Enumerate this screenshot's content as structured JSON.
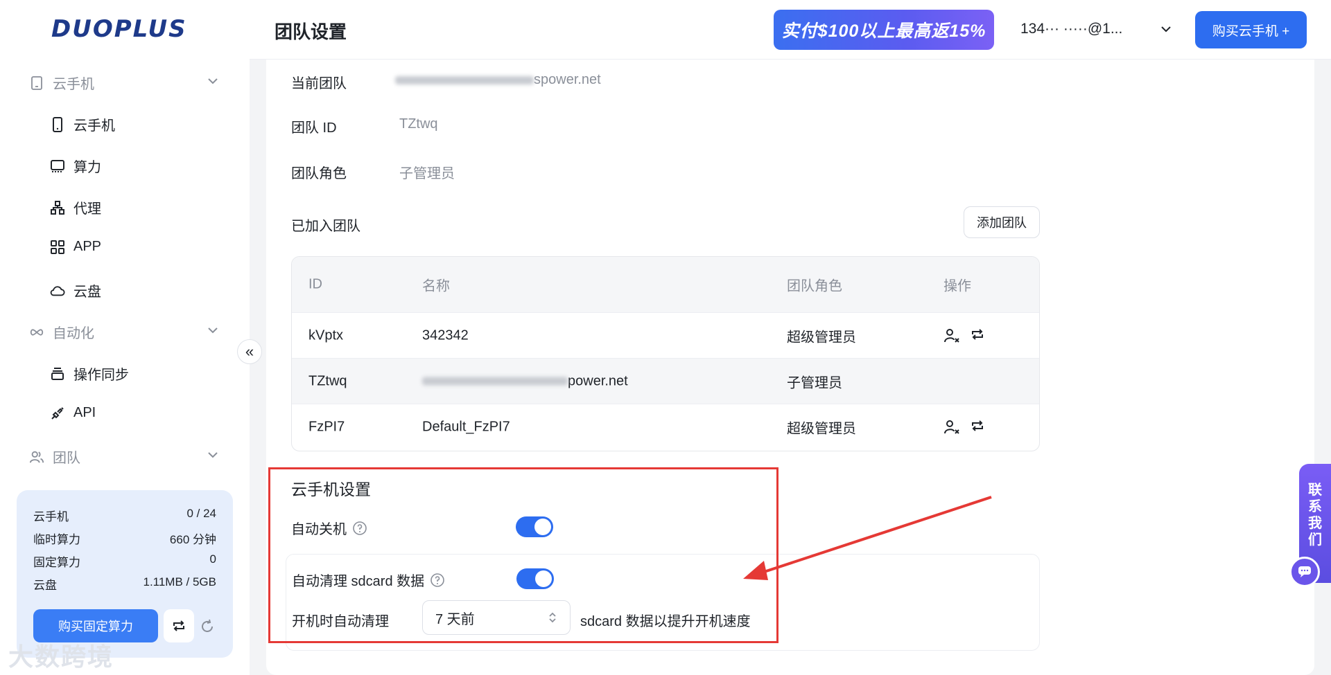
{
  "app": {
    "logo": "DUOPLUS",
    "watermark": "大数跨境"
  },
  "sidebar": {
    "groups": [
      {
        "label": "云手机",
        "icon": "phone-frame-icon"
      },
      {
        "label": "自动化",
        "icon": "infinity-icon"
      },
      {
        "label": "团队",
        "icon": "team-icon"
      }
    ],
    "items": [
      {
        "label": "云手机",
        "icon": "phone-icon"
      },
      {
        "label": "算力",
        "icon": "monitor-icon"
      },
      {
        "label": "代理",
        "icon": "network-icon"
      },
      {
        "label": "APP",
        "icon": "grid-icon"
      },
      {
        "label": "云盘",
        "icon": "cloud-icon"
      },
      {
        "label": "操作同步",
        "icon": "stack-icon"
      },
      {
        "label": "API",
        "icon": "plug-icon"
      }
    ],
    "usage": {
      "rows": [
        {
          "label": "云手机",
          "value": "0 / 24"
        },
        {
          "label": "临时算力",
          "value": "660 分钟"
        },
        {
          "label": "固定算力",
          "value": "0"
        },
        {
          "label": "云盘",
          "value": "1.11MB / 5GB"
        }
      ],
      "buy_fixed_label": "购买固定算力"
    }
  },
  "header": {
    "title": "团队设置",
    "promo": "实付$100以上最高返15%",
    "user_email": "134··· ·····@1...",
    "buy_button": "购买云手机 +"
  },
  "team_info": {
    "current_team_label": "当前团队",
    "current_team_value": "spower.net",
    "team_id_label": "团队 ID",
    "team_id_value": "TZtwq",
    "team_role_label": "团队角色",
    "team_role_value": "子管理员",
    "joined_label": "已加入团队",
    "add_team_label": "添加团队"
  },
  "table": {
    "headers": [
      "ID",
      "名称",
      "团队角色",
      "操作"
    ],
    "rows": [
      {
        "id": "kVptx",
        "name": "342342",
        "role": "超级管理员",
        "ops": true
      },
      {
        "id": "TZtwq",
        "name": "power.net",
        "role": "子管理员",
        "ops": false
      },
      {
        "id": "FzPI7",
        "name": "Default_FzPI7",
        "role": "超级管理员",
        "ops": true
      }
    ]
  },
  "phone_settings": {
    "title": "云手机设置",
    "auto_shutdown_label": "自动关机",
    "auto_shutdown_on": true,
    "auto_clean_label": "自动清理 sdcard 数据",
    "auto_clean_on": true,
    "boot_clean_prefix": "开机时自动清理",
    "boot_clean_value": "7 天前",
    "boot_clean_suffix": "sdcard 数据以提升开机速度"
  },
  "contact": {
    "label_chars": [
      "联",
      "系",
      "我",
      "们"
    ]
  },
  "colors": {
    "primary": "#2d6df0",
    "highlight": "#e53935",
    "contact": "#6a55ea"
  }
}
